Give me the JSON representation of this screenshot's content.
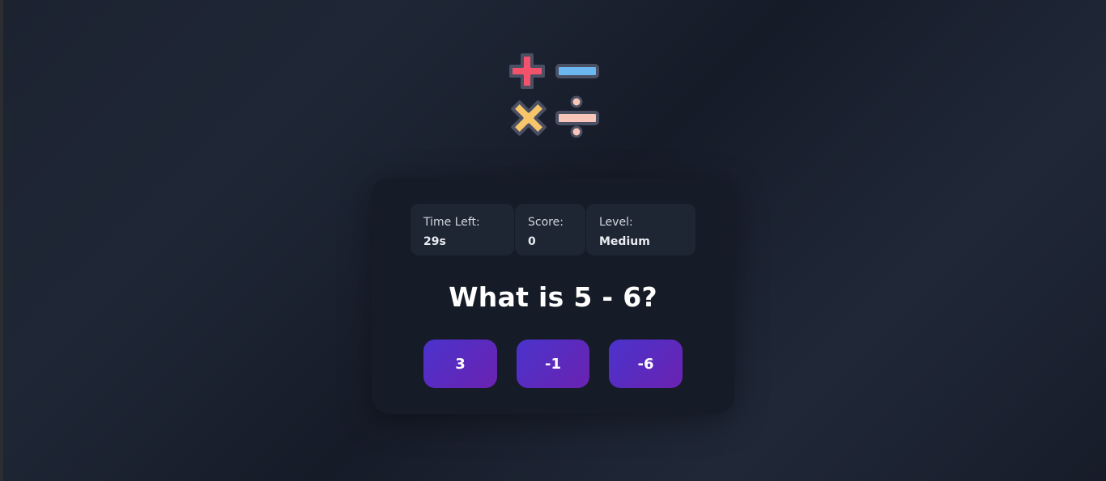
{
  "logo": {
    "icon": "math-operators-icon",
    "colors": {
      "plus": "#f2536b",
      "minus": "#6bb8f0",
      "multiply": "#f7c66b",
      "divide": "#f7c6b8",
      "outline": "#4a4f63"
    }
  },
  "stats": {
    "time": {
      "label": "Time Left:",
      "value": "29s"
    },
    "score": {
      "label": "Score:",
      "value": "0"
    },
    "level": {
      "label": "Level:",
      "value": "Medium"
    }
  },
  "question": "What is 5 - 6?",
  "answers": [
    "3",
    "-1",
    "-6"
  ],
  "colors": {
    "background": "#1c2230",
    "card": "#151b27",
    "stat_box": "#1e2533",
    "button_start": "#4a33cc",
    "button_end": "#6b22b0"
  }
}
